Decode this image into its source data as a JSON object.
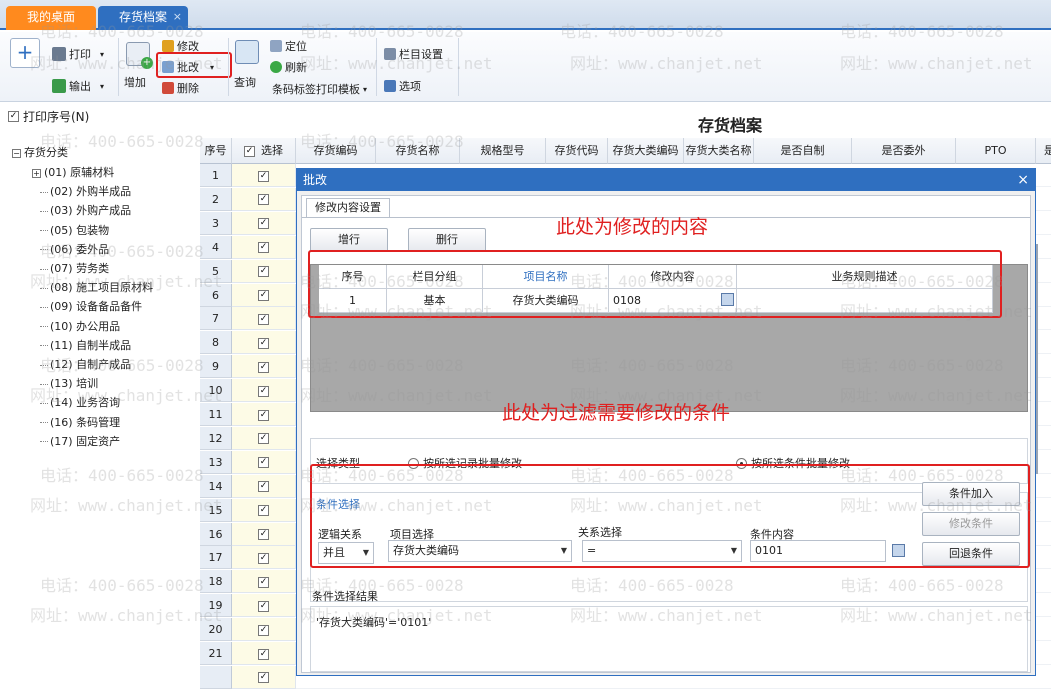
{
  "tabs": [
    {
      "label": "我的桌面"
    },
    {
      "label": "存货档案",
      "close": "×"
    }
  ],
  "toolbar": {
    "print": "打印",
    "export": "输出",
    "add": "增加",
    "modify": "修改",
    "batch_modify": "批改",
    "delete": "删除",
    "query": "查询",
    "locate": "定位",
    "refresh": "刷新",
    "barcode_print": "条码标签打印模板",
    "column_settings": "栏目设置",
    "options": "选项",
    "dropdown_arrow": "▾"
  },
  "print_seq": {
    "label": "打印序号(N)",
    "checked": true
  },
  "page_title": "存货档案",
  "tree": {
    "root": "存货分类",
    "items": [
      "(01) 原辅材料",
      "(02) 外购半成品",
      "(03) 外购产成品",
      "(05) 包装物",
      "(06) 委外品",
      "(07) 劳务类",
      "(08) 施工项目原材料",
      "(09) 设备备品备件",
      "(10) 办公用品",
      "(11) 自制半成品",
      "(12) 自制产成品",
      "(13) 培训",
      "(14) 业务咨询",
      "(16) 条码管理",
      "(17) 固定资产"
    ]
  },
  "grid": {
    "columns": [
      "序号",
      "选择",
      "存货编码",
      "存货名称",
      "规格型号",
      "存货代码",
      "存货大类编码",
      "存货大类名称",
      "是否自制",
      "是否委外",
      "PTO",
      "是否"
    ],
    "rows": [
      "1",
      "2",
      "3",
      "4",
      "5",
      "6",
      "7",
      "8",
      "9",
      "10",
      "11",
      "12",
      "13",
      "14",
      "15",
      "16",
      "17",
      "18",
      "19",
      "20",
      "21",
      ""
    ]
  },
  "dialog": {
    "title": "批改",
    "close": "×",
    "tab": "修改内容设置",
    "add_row": "增行",
    "delete_row": "删行",
    "table_headers": [
      "序号",
      "栏目分组",
      "项目名称",
      "修改内容",
      "业务规则描述"
    ],
    "table_row": {
      "seq": "1",
      "group": "基本",
      "item": "存货大类编码",
      "value": "0108",
      "desc": ""
    },
    "select_type_label": "选择类型",
    "option_selected_records": "按所选记录批量修改",
    "option_selected_conditions": "按所选条件批量修改",
    "selected_option": "按所选条件批量修改",
    "condition_section": "条件选择",
    "logic_label": "逻辑关系",
    "logic_value": "并且",
    "item_select_label": "项目选择",
    "item_select_value": "存货大类编码",
    "relation_label": "关系选择",
    "relation_value": "=",
    "condition_content_label": "条件内容",
    "condition_content_value": "0101",
    "add_condition": "条件加入",
    "modify_condition": "修改条件",
    "rollback_condition": "回退条件",
    "result_label": "条件选择结果",
    "result_value": "'存货大类编码'='0101'"
  },
  "annotations": {
    "modify_content": "此处为修改的内容",
    "filter_conditions": "此处为过滤需要修改的条件"
  },
  "watermark": {
    "phone": "电话：400-665-0028",
    "site": "网址：www.chanjet.net"
  },
  "colors": {
    "accent": "#2f6fc0",
    "desk_tab": "#ff8a1e",
    "annotation": "#e02020"
  }
}
